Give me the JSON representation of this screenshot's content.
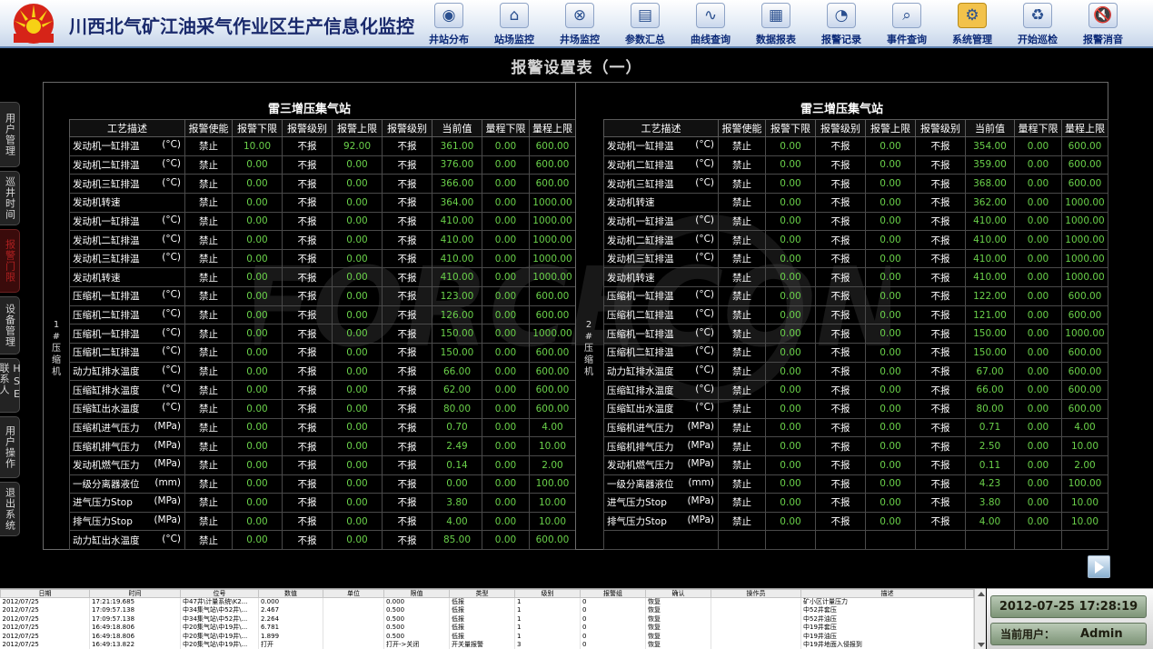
{
  "header": {
    "title": "川西北气矿江油采气作业区生产信息化监控",
    "nav": [
      {
        "label": "井站分布",
        "icon": "map-pin-icon",
        "glyph": "◉",
        "active": false
      },
      {
        "label": "站场监控",
        "icon": "station-monitor-icon",
        "glyph": "⌂",
        "active": false
      },
      {
        "label": "井场监控",
        "icon": "wellsite-monitor-icon",
        "glyph": "⊗",
        "active": false
      },
      {
        "label": "参数汇总",
        "icon": "parameter-summary-icon",
        "glyph": "▤",
        "active": false
      },
      {
        "label": "曲线查询",
        "icon": "curve-query-icon",
        "glyph": "∿",
        "active": false
      },
      {
        "label": "数据报表",
        "icon": "data-report-icon",
        "glyph": "▦",
        "active": false
      },
      {
        "label": "报警记录",
        "icon": "alarm-record-icon",
        "glyph": "◔",
        "active": false
      },
      {
        "label": "事件查询",
        "icon": "event-query-icon",
        "glyph": "⌕",
        "active": false
      },
      {
        "label": "系统管理",
        "icon": "system-management-icon",
        "glyph": "⚙",
        "active": true
      },
      {
        "label": "开始巡检",
        "icon": "start-inspection-icon",
        "glyph": "♻",
        "active": false
      },
      {
        "label": "报警消音",
        "icon": "alarm-mute-icon",
        "glyph": "🔇",
        "active": false
      }
    ]
  },
  "page_title": "报警设置表（一）",
  "sidebar": [
    {
      "label": "用户管理",
      "active": false
    },
    {
      "label": "巡井时间",
      "active": false
    },
    {
      "label": "报警门限",
      "active": true
    },
    {
      "label": "设备管理",
      "active": false
    },
    {
      "label": "HSE联系人",
      "active": false
    },
    {
      "label": "用户操作",
      "active": false
    },
    {
      "label": "退出系统",
      "active": false
    }
  ],
  "columns": [
    "工艺描述",
    "报警使能",
    "报警下限",
    "报警级别",
    "报警上限",
    "报警级别",
    "当前值",
    "量程下限",
    "量程上限"
  ],
  "panel1": {
    "station": "雷三增压集气站",
    "group": [
      "1",
      "#",
      "压",
      "缩",
      "机"
    ],
    "rows": [
      [
        "发动机一缸排温",
        "(°C)",
        "禁止",
        "10.00",
        "不报",
        "92.00",
        "不报",
        "361.00",
        "0.00",
        "600.00"
      ],
      [
        "发动机二缸排温",
        "(°C)",
        "禁止",
        "0.00",
        "不报",
        "0.00",
        "不报",
        "376.00",
        "0.00",
        "600.00"
      ],
      [
        "发动机三缸排温",
        "(°C)",
        "禁止",
        "0.00",
        "不报",
        "0.00",
        "不报",
        "366.00",
        "0.00",
        "600.00"
      ],
      [
        "发动机转速",
        "",
        "禁止",
        "0.00",
        "不报",
        "0.00",
        "不报",
        "364.00",
        "0.00",
        "1000.00"
      ],
      [
        "发动机一缸排温",
        "(°C)",
        "禁止",
        "0.00",
        "不报",
        "0.00",
        "不报",
        "410.00",
        "0.00",
        "1000.00"
      ],
      [
        "发动机二缸排温",
        "(°C)",
        "禁止",
        "0.00",
        "不报",
        "0.00",
        "不报",
        "410.00",
        "0.00",
        "1000.00"
      ],
      [
        "发动机三缸排温",
        "(°C)",
        "禁止",
        "0.00",
        "不报",
        "0.00",
        "不报",
        "410.00",
        "0.00",
        "1000.00"
      ],
      [
        "发动机转速",
        "",
        "禁止",
        "0.00",
        "不报",
        "0.00",
        "不报",
        "410.00",
        "0.00",
        "1000.00"
      ],
      [
        "压缩机一缸排温",
        "(°C)",
        "禁止",
        "0.00",
        "不报",
        "0.00",
        "不报",
        "123.00",
        "0.00",
        "600.00"
      ],
      [
        "压缩机二缸排温",
        "(°C)",
        "禁止",
        "0.00",
        "不报",
        "0.00",
        "不报",
        "126.00",
        "0.00",
        "600.00"
      ],
      [
        "压缩机一缸排温",
        "(°C)",
        "禁止",
        "0.00",
        "不报",
        "0.00",
        "不报",
        "150.00",
        "0.00",
        "1000.00"
      ],
      [
        "压缩机二缸排温",
        "(°C)",
        "禁止",
        "0.00",
        "不报",
        "0.00",
        "不报",
        "150.00",
        "0.00",
        "600.00"
      ],
      [
        "动力缸排水温度",
        "(°C)",
        "禁止",
        "0.00",
        "不报",
        "0.00",
        "不报",
        "66.00",
        "0.00",
        "600.00"
      ],
      [
        "压缩缸排水温度",
        "(°C)",
        "禁止",
        "0.00",
        "不报",
        "0.00",
        "不报",
        "62.00",
        "0.00",
        "600.00"
      ],
      [
        "压缩缸出水温度",
        "(°C)",
        "禁止",
        "0.00",
        "不报",
        "0.00",
        "不报",
        "80.00",
        "0.00",
        "600.00"
      ],
      [
        "压缩机进气压力",
        "(MPa)",
        "禁止",
        "0.00",
        "不报",
        "0.00",
        "不报",
        "0.70",
        "0.00",
        "4.00"
      ],
      [
        "压缩机排气压力",
        "(MPa)",
        "禁止",
        "0.00",
        "不报",
        "0.00",
        "不报",
        "2.49",
        "0.00",
        "10.00"
      ],
      [
        "发动机燃气压力",
        "(MPa)",
        "禁止",
        "0.00",
        "不报",
        "0.00",
        "不报",
        "0.14",
        "0.00",
        "2.00"
      ],
      [
        "一级分离器液位",
        "(mm)",
        "禁止",
        "0.00",
        "不报",
        "0.00",
        "不报",
        "0.00",
        "0.00",
        "100.00"
      ],
      [
        "进气压力Stop",
        "(MPa)",
        "禁止",
        "0.00",
        "不报",
        "0.00",
        "不报",
        "3.80",
        "0.00",
        "10.00"
      ],
      [
        "排气压力Stop",
        "(MPa)",
        "禁止",
        "0.00",
        "不报",
        "0.00",
        "不报",
        "4.00",
        "0.00",
        "10.00"
      ],
      [
        "动力缸出水温度",
        "(°C)",
        "禁止",
        "0.00",
        "不报",
        "0.00",
        "不报",
        "85.00",
        "0.00",
        "600.00"
      ]
    ]
  },
  "panel2": {
    "station": "雷三增压集气站",
    "group": [
      "2",
      "#",
      "压",
      "缩",
      "机"
    ],
    "rows": [
      [
        "发动机一缸排温",
        "(°C)",
        "禁止",
        "0.00",
        "不报",
        "0.00",
        "不报",
        "354.00",
        "0.00",
        "600.00"
      ],
      [
        "发动机二缸排温",
        "(°C)",
        "禁止",
        "0.00",
        "不报",
        "0.00",
        "不报",
        "359.00",
        "0.00",
        "600.00"
      ],
      [
        "发动机三缸排温",
        "(°C)",
        "禁止",
        "0.00",
        "不报",
        "0.00",
        "不报",
        "368.00",
        "0.00",
        "600.00"
      ],
      [
        "发动机转速",
        "",
        "禁止",
        "0.00",
        "不报",
        "0.00",
        "不报",
        "362.00",
        "0.00",
        "1000.00"
      ],
      [
        "发动机一缸排温",
        "(°C)",
        "禁止",
        "0.00",
        "不报",
        "0.00",
        "不报",
        "410.00",
        "0.00",
        "1000.00"
      ],
      [
        "发动机二缸排温",
        "(°C)",
        "禁止",
        "0.00",
        "不报",
        "0.00",
        "不报",
        "410.00",
        "0.00",
        "1000.00"
      ],
      [
        "发动机三缸排温",
        "(°C)",
        "禁止",
        "0.00",
        "不报",
        "0.00",
        "不报",
        "410.00",
        "0.00",
        "1000.00"
      ],
      [
        "发动机转速",
        "",
        "禁止",
        "0.00",
        "不报",
        "0.00",
        "不报",
        "410.00",
        "0.00",
        "1000.00"
      ],
      [
        "压缩机一缸排温",
        "(°C)",
        "禁止",
        "0.00",
        "不报",
        "0.00",
        "不报",
        "122.00",
        "0.00",
        "600.00"
      ],
      [
        "压缩机二缸排温",
        "(°C)",
        "禁止",
        "0.00",
        "不报",
        "0.00",
        "不报",
        "121.00",
        "0.00",
        "600.00"
      ],
      [
        "压缩机一缸排温",
        "(°C)",
        "禁止",
        "0.00",
        "不报",
        "0.00",
        "不报",
        "150.00",
        "0.00",
        "1000.00"
      ],
      [
        "压缩机二缸排温",
        "(°C)",
        "禁止",
        "0.00",
        "不报",
        "0.00",
        "不报",
        "150.00",
        "0.00",
        "600.00"
      ],
      [
        "动力缸排水温度",
        "(°C)",
        "禁止",
        "0.00",
        "不报",
        "0.00",
        "不报",
        "67.00",
        "0.00",
        "600.00"
      ],
      [
        "压缩缸排水温度",
        "(°C)",
        "禁止",
        "0.00",
        "不报",
        "0.00",
        "不报",
        "66.00",
        "0.00",
        "600.00"
      ],
      [
        "压缩缸出水温度",
        "(°C)",
        "禁止",
        "0.00",
        "不报",
        "0.00",
        "不报",
        "80.00",
        "0.00",
        "600.00"
      ],
      [
        "压缩机进气压力",
        "(MPa)",
        "禁止",
        "0.00",
        "不报",
        "0.00",
        "不报",
        "0.71",
        "0.00",
        "4.00"
      ],
      [
        "压缩机排气压力",
        "(MPa)",
        "禁止",
        "0.00",
        "不报",
        "0.00",
        "不报",
        "2.50",
        "0.00",
        "10.00"
      ],
      [
        "发动机燃气压力",
        "(MPa)",
        "禁止",
        "0.00",
        "不报",
        "0.00",
        "不报",
        "0.11",
        "0.00",
        "2.00"
      ],
      [
        "一级分离器液位",
        "(mm)",
        "禁止",
        "0.00",
        "不报",
        "0.00",
        "不报",
        "4.23",
        "0.00",
        "100.00"
      ],
      [
        "进气压力Stop",
        "(MPa)",
        "禁止",
        "0.00",
        "不报",
        "0.00",
        "不报",
        "3.80",
        "0.00",
        "10.00"
      ],
      [
        "排气压力Stop",
        "(MPa)",
        "禁止",
        "0.00",
        "不报",
        "0.00",
        "不报",
        "4.00",
        "0.00",
        "10.00"
      ],
      [
        "",
        "",
        "",
        "",
        "",
        "",
        "",
        "",
        "",
        ""
      ]
    ]
  },
  "log": {
    "columns": [
      "日期",
      "时间",
      "位号",
      "数值",
      "单位",
      "限值",
      "类型",
      "级别",
      "报警组",
      "确认",
      "操作员",
      "描述"
    ],
    "rows": [
      [
        "2012/07/25",
        "17:21:19.685",
        "中47井\\计量系统\\K2...",
        "0.000",
        "",
        "0.000",
        "低报",
        "1",
        "0",
        "恢复",
        "",
        "矿小区计量压力"
      ],
      [
        "2012/07/25",
        "17:09:57.138",
        "中34集气站\\中52井\\...",
        "2.467",
        "",
        "0.500",
        "低报",
        "1",
        "0",
        "恢复",
        "",
        "中52井套压"
      ],
      [
        "2012/07/25",
        "17:09:57.138",
        "中34集气站\\中52井\\...",
        "2.264",
        "",
        "0.500",
        "低报",
        "1",
        "0",
        "恢复",
        "",
        "中52井油压"
      ],
      [
        "2012/07/25",
        "16:49:18.806",
        "中20集气站\\中19井\\...",
        "6.781",
        "",
        "0.500",
        "低报",
        "1",
        "0",
        "恢复",
        "",
        "中19井套压"
      ],
      [
        "2012/07/25",
        "16:49:18.806",
        "中20集气站\\中19井\\...",
        "1.899",
        "",
        "0.500",
        "低报",
        "1",
        "0",
        "恢复",
        "",
        "中19井油压"
      ],
      [
        "2012/07/25",
        "16:49:13.822",
        "中20集气站\\中19井\\...",
        "打开",
        "",
        "打开->关闭",
        "开关量报警",
        "3",
        "0",
        "恢复",
        "",
        "中19井地面入侵报到"
      ]
    ]
  },
  "status": {
    "datetime": "2012-07-25 17:28:19",
    "user_label": "当前用户：",
    "user_value": "Admin"
  },
  "colors": {
    "value_green": "#6ad14a",
    "title_blue": "#1a2a6c",
    "active_tab_red": "#b02020"
  }
}
